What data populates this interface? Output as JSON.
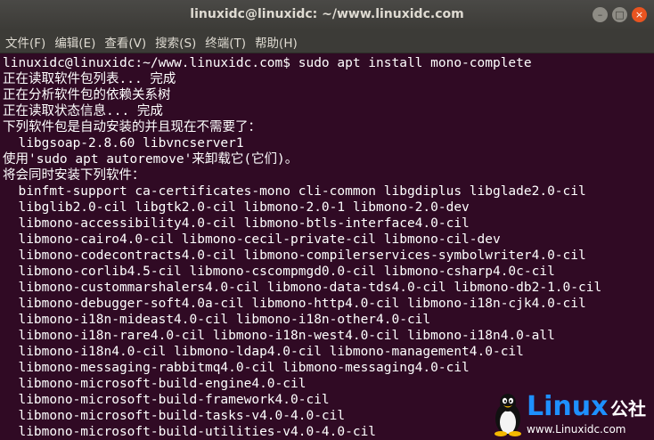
{
  "window": {
    "title": "linuxidc@linuxidc: ~/www.linuxidc.com",
    "minimize_glyph": "–",
    "maximize_glyph": "□",
    "close_glyph": "×"
  },
  "menubar": {
    "items": [
      "文件(F)",
      "编辑(E)",
      "查看(V)",
      "搜索(S)",
      "终端(T)",
      "帮助(H)"
    ]
  },
  "terminal": {
    "lines": [
      "linuxidc@linuxidc:~/www.linuxidc.com$ sudo apt install mono-complete",
      "正在读取软件包列表... 完成",
      "正在分析软件包的依赖关系树",
      "正在读取状态信息... 完成",
      "下列软件包是自动安装的并且现在不需要了：",
      "  libgsoap-2.8.60 libvncserver1",
      "使用'sudo apt autoremove'来卸载它(它们)。",
      "将会同时安装下列软件：",
      "  binfmt-support ca-certificates-mono cli-common libgdiplus libglade2.0-cil",
      "  libglib2.0-cil libgtk2.0-cil libmono-2.0-1 libmono-2.0-dev",
      "  libmono-accessibility4.0-cil libmono-btls-interface4.0-cil",
      "  libmono-cairo4.0-cil libmono-cecil-private-cil libmono-cil-dev",
      "  libmono-codecontracts4.0-cil libmono-compilerservices-symbolwriter4.0-cil",
      "  libmono-corlib4.5-cil libmono-cscompmgd0.0-cil libmono-csharp4.0c-cil",
      "  libmono-custommarshalers4.0-cil libmono-data-tds4.0-cil libmono-db2-1.0-cil",
      "  libmono-debugger-soft4.0a-cil libmono-http4.0-cil libmono-i18n-cjk4.0-cil",
      "  libmono-i18n-mideast4.0-cil libmono-i18n-other4.0-cil",
      "  libmono-i18n-rare4.0-cil libmono-i18n-west4.0-cil libmono-i18n4.0-all",
      "  libmono-i18n4.0-cil libmono-ldap4.0-cil libmono-management4.0-cil",
      "  libmono-messaging-rabbitmq4.0-cil libmono-messaging4.0-cil",
      "  libmono-microsoft-build-engine4.0-cil",
      "  libmono-microsoft-build-framework4.0-cil",
      "  libmono-microsoft-build-tasks-v4.0-4.0-cil",
      "  libmono-microsoft-build-utilities-v4.0-4.0-cil"
    ]
  },
  "watermark": {
    "brand": "Linux",
    "brand_suffix": "公社",
    "url": "www.Linuxidc.com",
    "brand_color": "#1e90ff"
  },
  "colors": {
    "terminal_bg": "#300a24",
    "terminal_fg": "#ffffff",
    "titlebar_bg": "#3c3b37",
    "close_button": "#e95420"
  }
}
